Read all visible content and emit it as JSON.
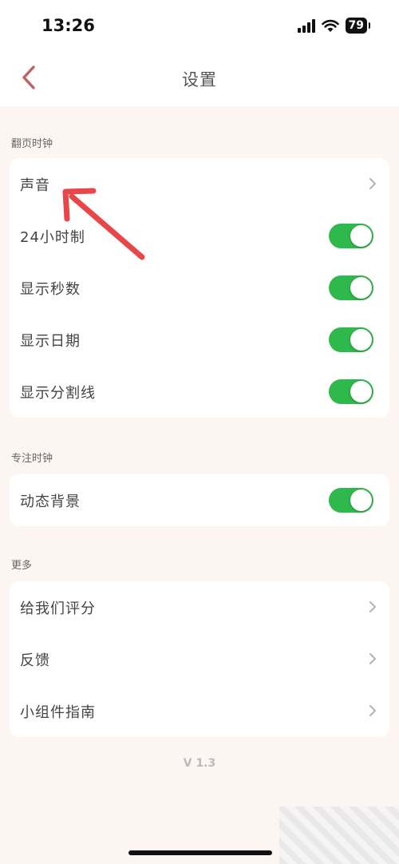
{
  "status_bar": {
    "time": "13:26",
    "battery": "79"
  },
  "nav": {
    "title": "设置"
  },
  "sections": [
    {
      "label": "翻页时钟",
      "rows": [
        {
          "label": "声音",
          "control": "chevron"
        },
        {
          "label": "24小时制",
          "control": "toggle",
          "on": true
        },
        {
          "label": "显示秒数",
          "control": "toggle",
          "on": true
        },
        {
          "label": "显示日期",
          "control": "toggle",
          "on": true
        },
        {
          "label": "显示分割线",
          "control": "toggle",
          "on": true
        }
      ]
    },
    {
      "label": "专注时钟",
      "rows": [
        {
          "label": "动态背景",
          "control": "toggle",
          "on": true
        }
      ]
    },
    {
      "label": "更多",
      "rows": [
        {
          "label": "给我们评分",
          "control": "chevron"
        },
        {
          "label": "反馈",
          "control": "chevron"
        },
        {
          "label": "小组件指南",
          "control": "chevron"
        }
      ]
    }
  ],
  "version": "V 1.3",
  "colors": {
    "accent": "#c0625f",
    "toggle_on": "#2fb84b",
    "annotation": "#e8474a",
    "background": "#fdf5f2"
  }
}
